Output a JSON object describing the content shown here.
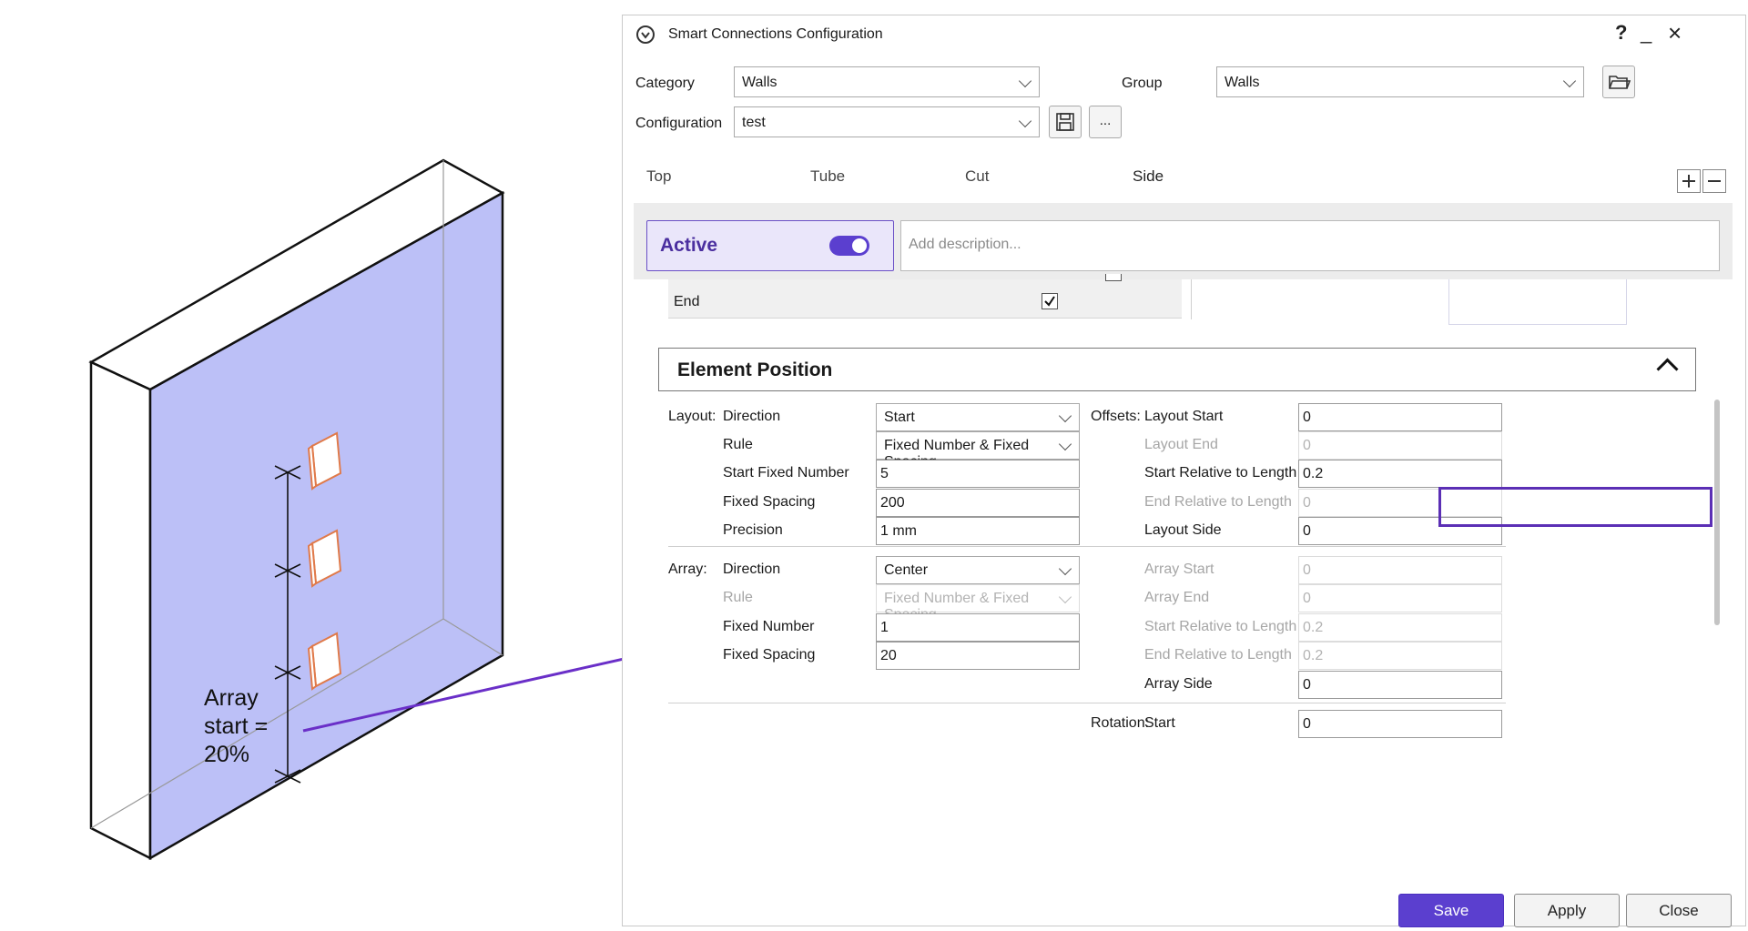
{
  "illustration": {
    "label_lines": [
      "Array",
      "start =",
      "20%"
    ],
    "wall_color": "#bcc0f7",
    "arrow_color": "#6a2fc8"
  },
  "window": {
    "title": "Smart Connections Configuration",
    "help_label": "?",
    "minimize_label": "_",
    "close_label": "×",
    "logo_icon": "smart-connections-logo-icon"
  },
  "header": {
    "category_label": "Category",
    "category_value": "Walls",
    "group_label": "Group",
    "group_value": "Walls",
    "configuration_label": "Configuration",
    "configuration_value": "test",
    "more_button_label": "..."
  },
  "tabs": [
    {
      "label": "Top",
      "active": false
    },
    {
      "label": "Tube",
      "active": false
    },
    {
      "label": "Cut",
      "active": false
    },
    {
      "label": "Side",
      "active": true
    }
  ],
  "active_panel": {
    "label": "Active",
    "toggle_on": true,
    "description_placeholder": "Add description..."
  },
  "end_row": {
    "label": "End",
    "checked": true
  },
  "section": {
    "title": "Element Position"
  },
  "layout": {
    "group_label": "Layout:",
    "direction_label": "Direction",
    "direction_value": "Start",
    "rule_label": "Rule",
    "rule_value": "Fixed Number & Fixed Spacing",
    "start_fixed_number_label": "Start Fixed Number",
    "start_fixed_number_value": "5",
    "fixed_spacing_label": "Fixed Spacing",
    "fixed_spacing_value": "200",
    "precision_label": "Precision",
    "precision_value": "1 mm"
  },
  "offsets": {
    "group_label": "Offsets:",
    "layout_start_label": "Layout Start",
    "layout_start_value": "0",
    "layout_end_label": "Layout End",
    "layout_end_value": "0",
    "start_relative_label": "Start Relative to Length",
    "start_relative_value": "0.2",
    "end_relative_label": "End Relative to Length",
    "end_relative_value": "0",
    "layout_side_label": "Layout Side",
    "layout_side_value": "0"
  },
  "array": {
    "group_label": "Array:",
    "direction_label": "Direction",
    "direction_value": "Center",
    "rule_label": "Rule",
    "rule_value": "Fixed Number & Fixed Spacing",
    "fixed_number_label": "Fixed Number",
    "fixed_number_value": "1",
    "fixed_spacing_label": "Fixed Spacing",
    "fixed_spacing_value": "20",
    "array_start_label": "Array Start",
    "array_start_value": "0",
    "array_end_label": "Array End",
    "array_end_value": "0",
    "start_relative_label": "Start Relative to Length",
    "start_relative_value": "0.2",
    "end_relative_label": "End Relative to Length",
    "end_relative_value": "0.2",
    "array_side_label": "Array Side",
    "array_side_value": "0"
  },
  "rotation": {
    "group_label": "Rotation:",
    "start_label": "Start",
    "start_value": "0"
  },
  "footer": {
    "save_label": "Save",
    "apply_label": "Apply",
    "close_label": "Close"
  }
}
